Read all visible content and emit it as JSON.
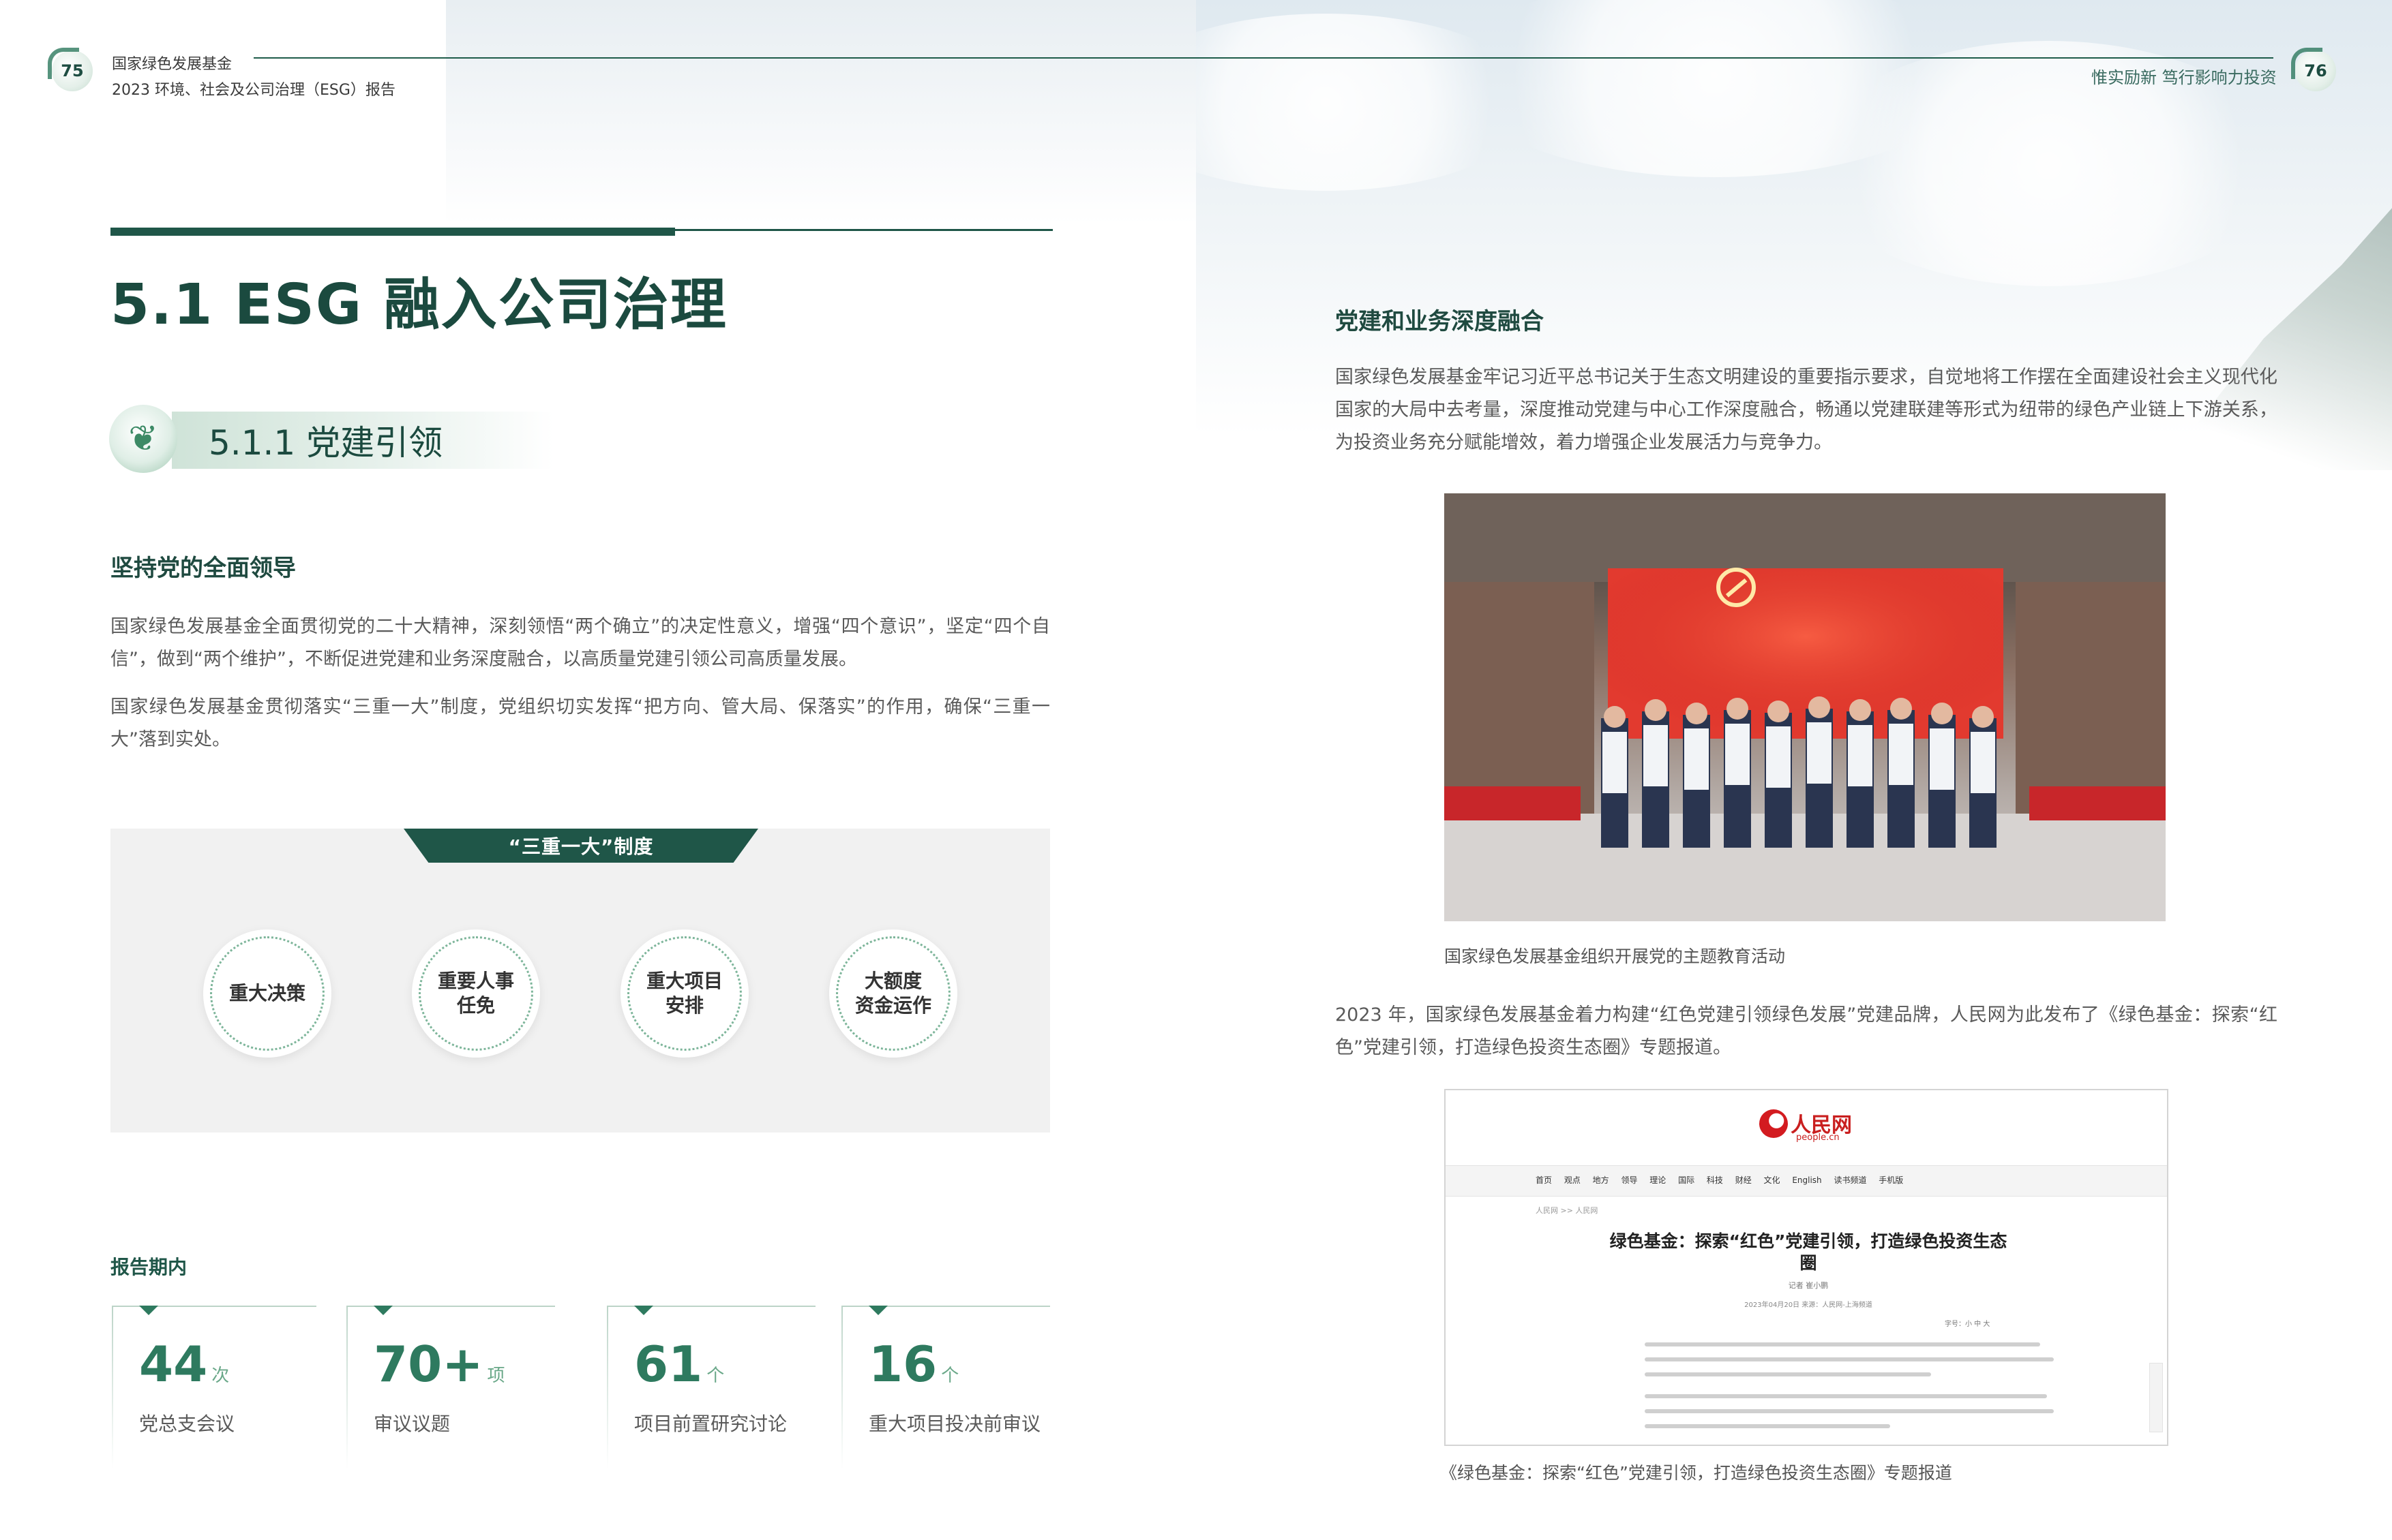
{
  "left_page": {
    "page_number": "75",
    "header": {
      "org": "国家绿色发展基金",
      "report": "2023  环境、社会及公司治理（ESG）报告"
    },
    "section_title": "5.1 ESG 融入公司治理",
    "subsection_title": "5.1.1 党建引领",
    "heading_leadership": "坚持党的全面领导",
    "para_1": "国家绿色发展基金全面贯彻党的二十大精神，深刻领悟“两个确立”的决定性意义，增强“四个意识”，坚定“四个自信”，做到“两个维护”，不断促进党建和业务深度融合，以高质量党建引领公司高质量发展。",
    "para_2": "国家绿色发展基金贯彻落实“三重一大”制度，党组织切实发挥“把方向、管大局、保落实”的作用，确保“三重一大”落到实处。",
    "system": {
      "title": "“三重一大”制度",
      "items": [
        {
          "line1": "重大决策",
          "line2": ""
        },
        {
          "line1": "重要人事",
          "line2": "任免"
        },
        {
          "line1": "重大项目",
          "line2": "安排"
        },
        {
          "line1": "大额度",
          "line2": "资金运作"
        }
      ]
    },
    "stats_label": "报告期内",
    "stats": [
      {
        "value": "44",
        "unit": "次",
        "label": "党总支会议"
      },
      {
        "value": "70+",
        "unit": "项",
        "label": "审议议题"
      },
      {
        "value": "61",
        "unit": "个",
        "label": "项目前置研究讨论"
      },
      {
        "value": "16",
        "unit": "个",
        "label": "重大项目投决前审议"
      }
    ]
  },
  "right_page": {
    "page_number": "76",
    "slogan": "惟实励新  笃行影响力投资",
    "heading_integration": "党建和业务深度融合",
    "para_1": "国家绿色发展基金牢记习近平总书记关于生态文明建设的重要指示要求，自觉地将工作摆在全面建设社会主义现代化国家的大局中去考量，深度推动党建与中心工作深度融合，畅通以党建联建等形式为纽带的绿色产业链上下游关系，为投资业务充分赋能增效，着力增强企业发展活力与竞争力。",
    "photo_caption": "国家绿色发展基金组织开展党的主题教育活动",
    "para_2": "2023 年，国家绿色发展基金着力构建“红色党建引领绿色发展”党建品牌，人民网为此发布了《绿色基金：探索“红色”党建引领，打造绿色投资生态圈》专题报道。",
    "web": {
      "logo_text": "人民网",
      "logo_sub": "people.cn",
      "nav": "首页 观点 地方 领导 理论 国际 科技 财经 文化 English 读书频道 手机版",
      "crumb": "人民网 >> 人民网",
      "article_title": "绿色基金：探索“红色”党建引领，打造绿色投资生态圈",
      "article_meta": "记者 崔小鹏",
      "article_meta2": "2023年04月20日 来源：人民网-上海频道",
      "tools": "字号：小 中 大"
    },
    "web_caption": "《绿色基金：探索“红色”党建引领，打造绿色投资生态圈》专题报道"
  },
  "colors": {
    "brand_dark_green": "#1f5648",
    "accent_green": "#2e7a5f",
    "panel_grey": "#f1f1f1"
  },
  "icons": [
    "leaf-badge-icon",
    "party-emblem-icon",
    "people-logo-icon"
  ]
}
